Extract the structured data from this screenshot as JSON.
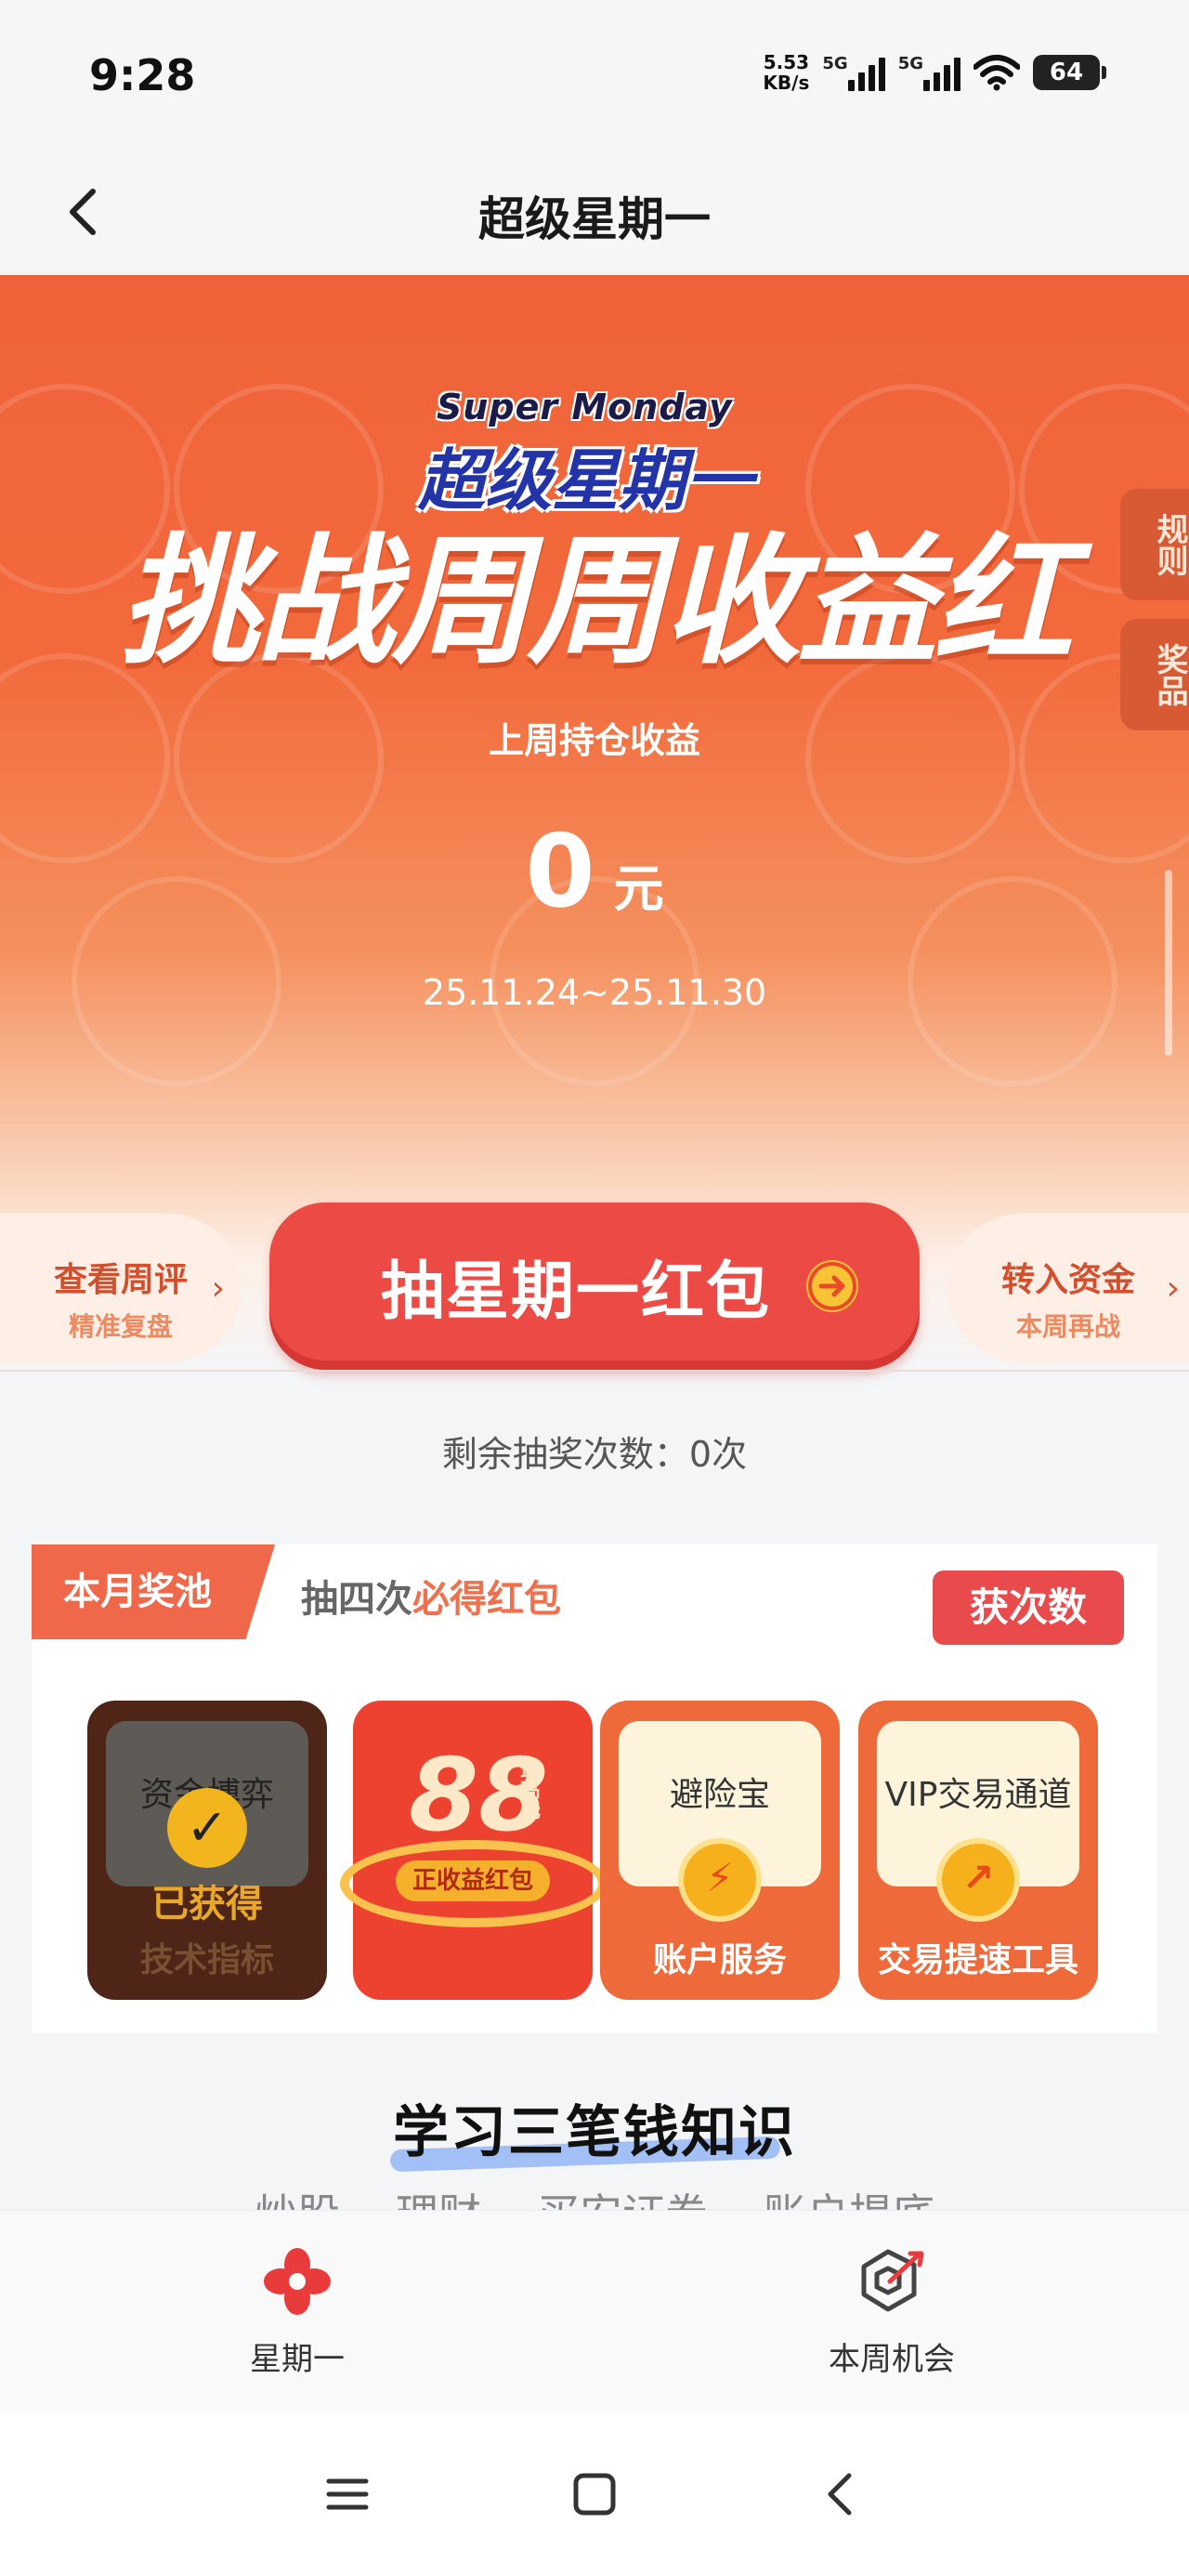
{
  "status_bar": {
    "time": "9:28",
    "net_speed_value": "5.53",
    "net_speed_unit": "KB/s",
    "signal_1_label": "5G",
    "signal_2_label": "5G",
    "battery": "64"
  },
  "header": {
    "title": "超级星期一"
  },
  "hero": {
    "logo_en": "Super Monday",
    "logo_cn": "超级星期一",
    "headline": "挑战周周收益红",
    "subtitle": "上周持仓收益",
    "amount": "0",
    "amount_unit": "元",
    "date_range": "25.11.24~25.11.30",
    "side_rules": "规则",
    "side_prizes": "奖品"
  },
  "actions": {
    "review_main": "查看周评",
    "review_sub": "精准复盘",
    "draw_label": "抽星期一红包",
    "transfer_main": "转入资金",
    "transfer_sub": "本周再战"
  },
  "remaining": "剩余抽奖次数：0次",
  "prize_pool": {
    "tag": "本月奖池",
    "desc_prefix": "抽四次",
    "desc_highlight": "必得红包",
    "get_button": "获次数",
    "prizes": [
      {
        "name": "资金博弈",
        "status": "已获得",
        "caption": "技术指标"
      },
      {
        "amount": "88",
        "side": "最高元",
        "ribbon": "正收益红包"
      },
      {
        "name": "避险宝",
        "caption": "账户服务"
      },
      {
        "name": "VIP交易通道",
        "caption": "交易提速工具"
      }
    ]
  },
  "learn": {
    "title": "学习三笔钱知识",
    "tabs": [
      "炒股",
      "理财",
      "买安证券",
      "账户揭底"
    ]
  },
  "tab_bar": {
    "monday": "星期一",
    "week": "本周机会"
  },
  "colors": {
    "brand": "#f0623a",
    "draw_button": "#ec4a45",
    "highlight": "#f06f4c"
  }
}
